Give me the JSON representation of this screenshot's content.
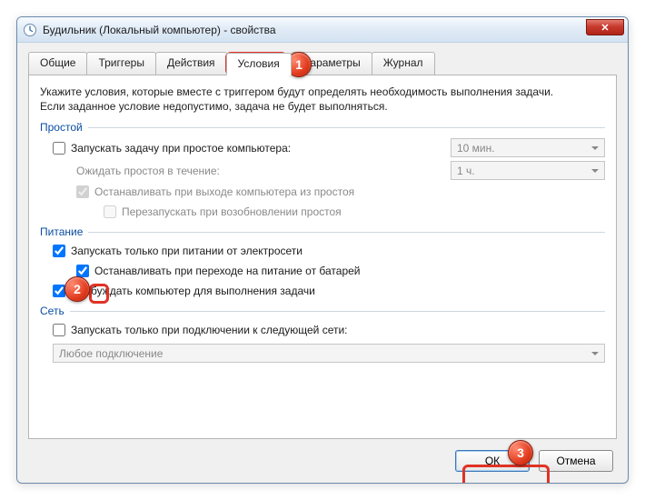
{
  "window": {
    "title": "Будильник (Локальный компьютер) - свойства"
  },
  "tabs": {
    "general": "Общие",
    "triggers": "Триггеры",
    "actions": "Действия",
    "conditions": "Условия",
    "parameters": "Параметры",
    "journal": "Журнал"
  },
  "desc_line1": "Укажите условия, которые вместе с триггером будут определять необходимость выполнения задачи.",
  "desc_line2": "Если заданное условие недопустимо, задача не будет выполняться.",
  "idle": {
    "title": "Простой",
    "start_if_idle": "Запускать задачу при простое компьютера:",
    "idle_duration": "10 мин.",
    "wait_for_idle_label": "Ожидать простоя в течение:",
    "wait_for_idle_value": "1 ч.",
    "stop_if_not_idle": "Останавливать при выходе компьютера из простоя",
    "restart_if_idle": "Перезапускать при возобновлении простоя"
  },
  "power": {
    "title": "Питание",
    "only_on_ac": "Запускать только при питании от электросети",
    "stop_on_battery": "Останавливать при переходе на питание от батарей",
    "wake_to_run": "Пробуждать компьютер для выполнения задачи"
  },
  "network": {
    "title": "Сеть",
    "only_if_network": "Запускать только при подключении к следующей сети:",
    "any_connection": "Любое подключение"
  },
  "buttons": {
    "ok": "ОК",
    "cancel": "Отмена"
  },
  "badges": {
    "b1": "1",
    "b2": "2",
    "b3": "3"
  }
}
